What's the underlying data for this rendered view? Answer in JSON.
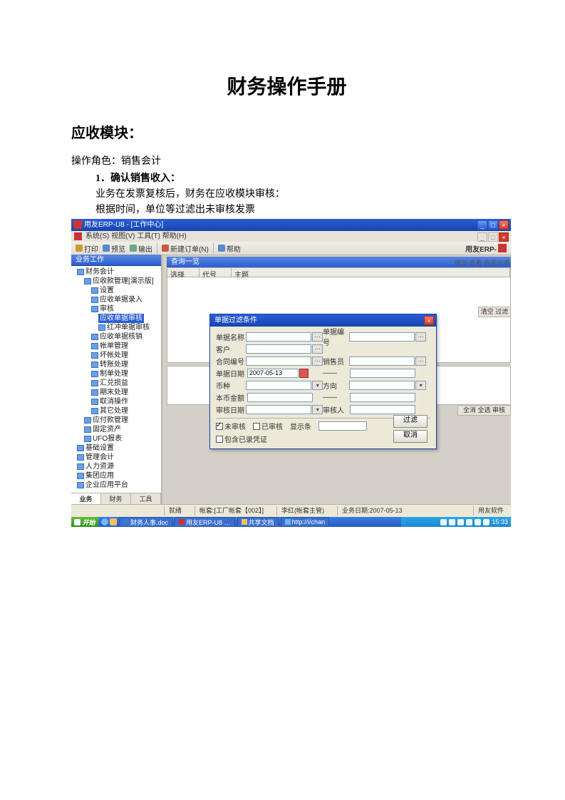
{
  "doc": {
    "title": "财务操作手册",
    "section": "应收模块：",
    "role_line": "操作角色：销售会计",
    "step1": "1．确认销售收入：",
    "line2": "业务在发票复核后，财务在应收模块审核：",
    "line3": "根据时间，单位等过滤出未审核发票"
  },
  "erp": {
    "outer_title": "用友ERP-U8 - [工作中心]",
    "inner_title": "系统(S) 视图(V) 工具(T) 帮助(H)",
    "toolbar": {
      "items": [
        "打印",
        "预览",
        "输出",
        "新建订单(N)",
        "帮助"
      ],
      "brand": "用友ERP-"
    },
    "sidebar": {
      "title": "业务工作",
      "tree": [
        {
          "l": 1,
          "t": "财务会计"
        },
        {
          "l": 2,
          "t": "应收款管理[演示版]"
        },
        {
          "l": 3,
          "t": "设置"
        },
        {
          "l": 3,
          "t": "应收单据录入"
        },
        {
          "l": 3,
          "t": "审核"
        },
        {
          "l": 4,
          "t": "应收单据审核",
          "sel": true
        },
        {
          "l": 4,
          "t": "红冲单据审核"
        },
        {
          "l": 3,
          "t": "应收单据核销"
        },
        {
          "l": 3,
          "t": "帐单管理"
        },
        {
          "l": 3,
          "t": "坏帐处理"
        },
        {
          "l": 3,
          "t": "转账处理"
        },
        {
          "l": 3,
          "t": "制单处理"
        },
        {
          "l": 3,
          "t": "汇兑损益"
        },
        {
          "l": 3,
          "t": "期末处理"
        },
        {
          "l": 3,
          "t": "取消操作"
        },
        {
          "l": 3,
          "t": "其它处理"
        },
        {
          "l": 2,
          "t": "应付款管理"
        },
        {
          "l": 2,
          "t": "固定资产"
        },
        {
          "l": 2,
          "t": "UFO报表"
        },
        {
          "l": 1,
          "t": "基础设置"
        },
        {
          "l": 1,
          "t": "管理会计"
        },
        {
          "l": 1,
          "t": "人力资源"
        },
        {
          "l": 1,
          "t": "集团应用"
        },
        {
          "l": 1,
          "t": "企业应用平台"
        }
      ],
      "tabs": [
        "业务",
        "财务",
        "工具"
      ]
    },
    "content": {
      "inner_win_title": "查询一览",
      "grid_cols": [
        "选择",
        "代号",
        "主题"
      ],
      "right_header": "增加 查看 自定义项",
      "side1": "清空 过滤",
      "side2": "全消 全选 审核"
    },
    "dialog": {
      "title": "单据过滤条件",
      "rows": [
        {
          "l": "单据名称",
          "r": "单据编号",
          "lv": "",
          "rv": ""
        },
        {
          "l": "客户",
          "r": "",
          "lv": "",
          "rv": ""
        },
        {
          "l": "合同编号",
          "r": "销售员",
          "lv": "",
          "rv": ""
        },
        {
          "l": "单据日期",
          "r": "——",
          "lv": "2007-05-13",
          "rv": ""
        },
        {
          "l": "币种",
          "r": "方向",
          "lv": "",
          "rv": ""
        },
        {
          "l": "本币金额",
          "r": "——",
          "lv": "",
          "rv": ""
        },
        {
          "l": "审核日期",
          "r": "审核人",
          "lv": "",
          "rv": ""
        }
      ],
      "chk1": "未审核",
      "chk2": "已审核",
      "chk3": "包含已录凭证",
      "num_label": "显示条",
      "num_value": "",
      "btn_filter": "过滤",
      "btn_cancel": "取消"
    },
    "statusbar": {
      "c1": "就绪",
      "c2": "帐套:[工厂帐套【002】]",
      "c3": "李红(帐套主管)",
      "c4": "业务日期:2007-05-13",
      "c5": "用友软件"
    },
    "taskbar": {
      "start": "开始",
      "items": [
        "财务人事.doc",
        "用友ERP-U8 …",
        "共享文档",
        "http://i/chan"
      ],
      "clock": "15:33"
    }
  }
}
